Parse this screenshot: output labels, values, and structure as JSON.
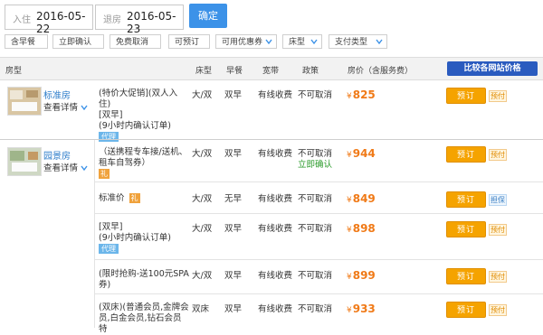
{
  "search": {
    "checkin_label": "入住",
    "checkin_date": "2016-05-22",
    "checkout_label": "退房",
    "checkout_date": "2016-05-23",
    "confirm_label": "确定"
  },
  "filters": [
    "含早餐",
    "立即确认",
    "免费取消",
    "可预订",
    "可用优惠券",
    "床型",
    "支付类型"
  ],
  "header": {
    "room_type": "房型",
    "bed": "床型",
    "breakfast": "早餐",
    "broadband": "宽带",
    "policy": "政策",
    "price": "房价（含服务费）",
    "compare": "比较各网站价格"
  },
  "rooms": [
    {
      "name": "标准房",
      "details": "查看详情",
      "offers": [
        {
          "desc": [
            "(特价大促销](双人入住)",
            "[双早]",
            "(9小时内确认订单)"
          ],
          "agent": "代理",
          "bed": "大/双",
          "breakfast": "双早",
          "broadband": "有线收费",
          "policy": "不可取消",
          "currency": "¥",
          "price": "825",
          "book": "预订",
          "pay": "预付"
        }
      ]
    },
    {
      "name": "园景房",
      "details": "查看详情",
      "offers": [
        {
          "desc": [
            "（送携程专车接/送机、",
            "租车自驾券）"
          ],
          "gift": "礼",
          "bed": "大/双",
          "breakfast": "双早",
          "broadband": "有线收费",
          "policy": "不可取消",
          "policy2": "立即确认",
          "currency": "¥",
          "price": "944",
          "book": "预订",
          "pay": "预付"
        },
        {
          "desc": [
            "标准价"
          ],
          "gift": "礼",
          "bed": "大/双",
          "breakfast": "无早",
          "broadband": "有线收费",
          "policy": "不可取消",
          "currency": "¥",
          "price": "849",
          "book": "预订",
          "pay": "担保"
        },
        {
          "desc": [
            "[双早]",
            "(9小时内确认订单)"
          ],
          "agent": "代理",
          "bed": "大/双",
          "breakfast": "双早",
          "broadband": "有线收费",
          "policy": "不可取消",
          "currency": "¥",
          "price": "898",
          "book": "预订",
          "pay": "预付"
        },
        {
          "desc": [
            "(限时抢购-送100元SPA",
            "券)"
          ],
          "bed": "大/双",
          "breakfast": "双早",
          "broadband": "有线收费",
          "policy": "不可取消",
          "currency": "¥",
          "price": "899",
          "book": "预订",
          "pay": "预付"
        },
        {
          "desc": [
            "(双床)(普通会员,金牌会",
            "员,白金会员,钻石会员 特"
          ],
          "bed": "双床",
          "breakfast": "双早",
          "broadband": "有线收费",
          "policy": "不可取消",
          "currency": "¥",
          "price": "933",
          "book": "预订",
          "pay": "预付"
        }
      ]
    }
  ],
  "colors": {
    "accent": "#3c92e8",
    "price": "#f07a17",
    "book": "#f5a300",
    "compare": "#2a5bbf"
  }
}
